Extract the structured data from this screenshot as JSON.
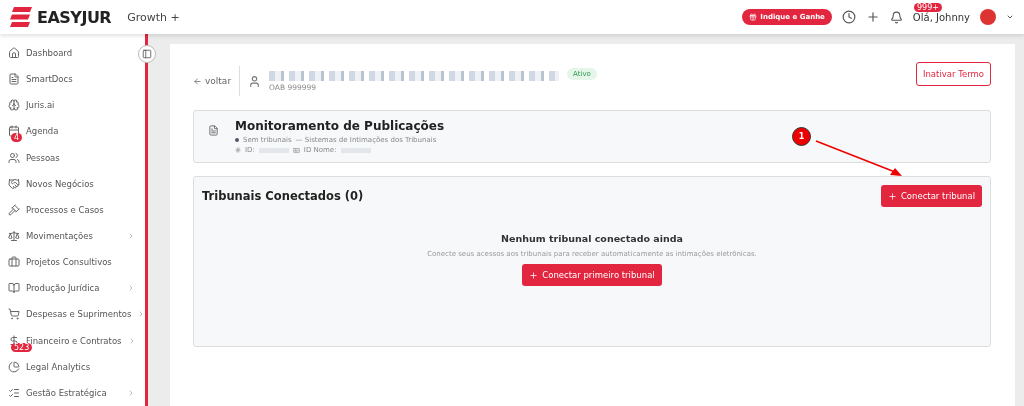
{
  "header": {
    "logo": "EASYJUR",
    "plan": "Growth +",
    "referral_button": "Indique e Ganhe",
    "notification_badge": "999+",
    "greeting": "Olá, Johnny"
  },
  "sidebar": {
    "items": [
      {
        "label": "Dashboard",
        "expandable": false
      },
      {
        "label": "SmartDocs",
        "expandable": false
      },
      {
        "label": "Juris.ai",
        "expandable": false
      },
      {
        "label": "Agenda",
        "expandable": false,
        "badge": "4"
      },
      {
        "label": "Pessoas",
        "expandable": false
      },
      {
        "label": "Novos Negócios",
        "expandable": false
      },
      {
        "label": "Processos e Casos",
        "expandable": false
      },
      {
        "label": "Movimentações",
        "expandable": true
      },
      {
        "label": "Projetos Consultivos",
        "expandable": false
      },
      {
        "label": "Produção Jurídica",
        "expandable": true
      },
      {
        "label": "Despesas e Suprimentos",
        "expandable": true
      },
      {
        "label": "Financeiro e Contratos",
        "expandable": true,
        "badge": "523"
      },
      {
        "label": "Legal Analytics",
        "expandable": false
      },
      {
        "label": "Gestão Estratégica",
        "expandable": true
      }
    ]
  },
  "profile": {
    "back_link": "voltar",
    "oab": "OAB 999999",
    "status": "Ativo",
    "deactivate_button": "Inativar Termo"
  },
  "monitor_card": {
    "title": "Monitoramento de Publicações",
    "status": "Sem tribunais",
    "description": "— Sistemas de Intimações dos Tribunais",
    "id_label": "ID:",
    "id_name_label": "ID Nome:"
  },
  "courts_section": {
    "title": "Tribunais Conectados (0)",
    "connect_button": "Conectar tribunal",
    "empty_title": "Nenhum tribunal conectado ainda",
    "empty_text": "Conecte seus acessos aos tribunais para receber automaticamente as intimações eletrônicas.",
    "primary_button": "Conectar primeiro tribunal"
  },
  "annotation": {
    "label": "1"
  }
}
